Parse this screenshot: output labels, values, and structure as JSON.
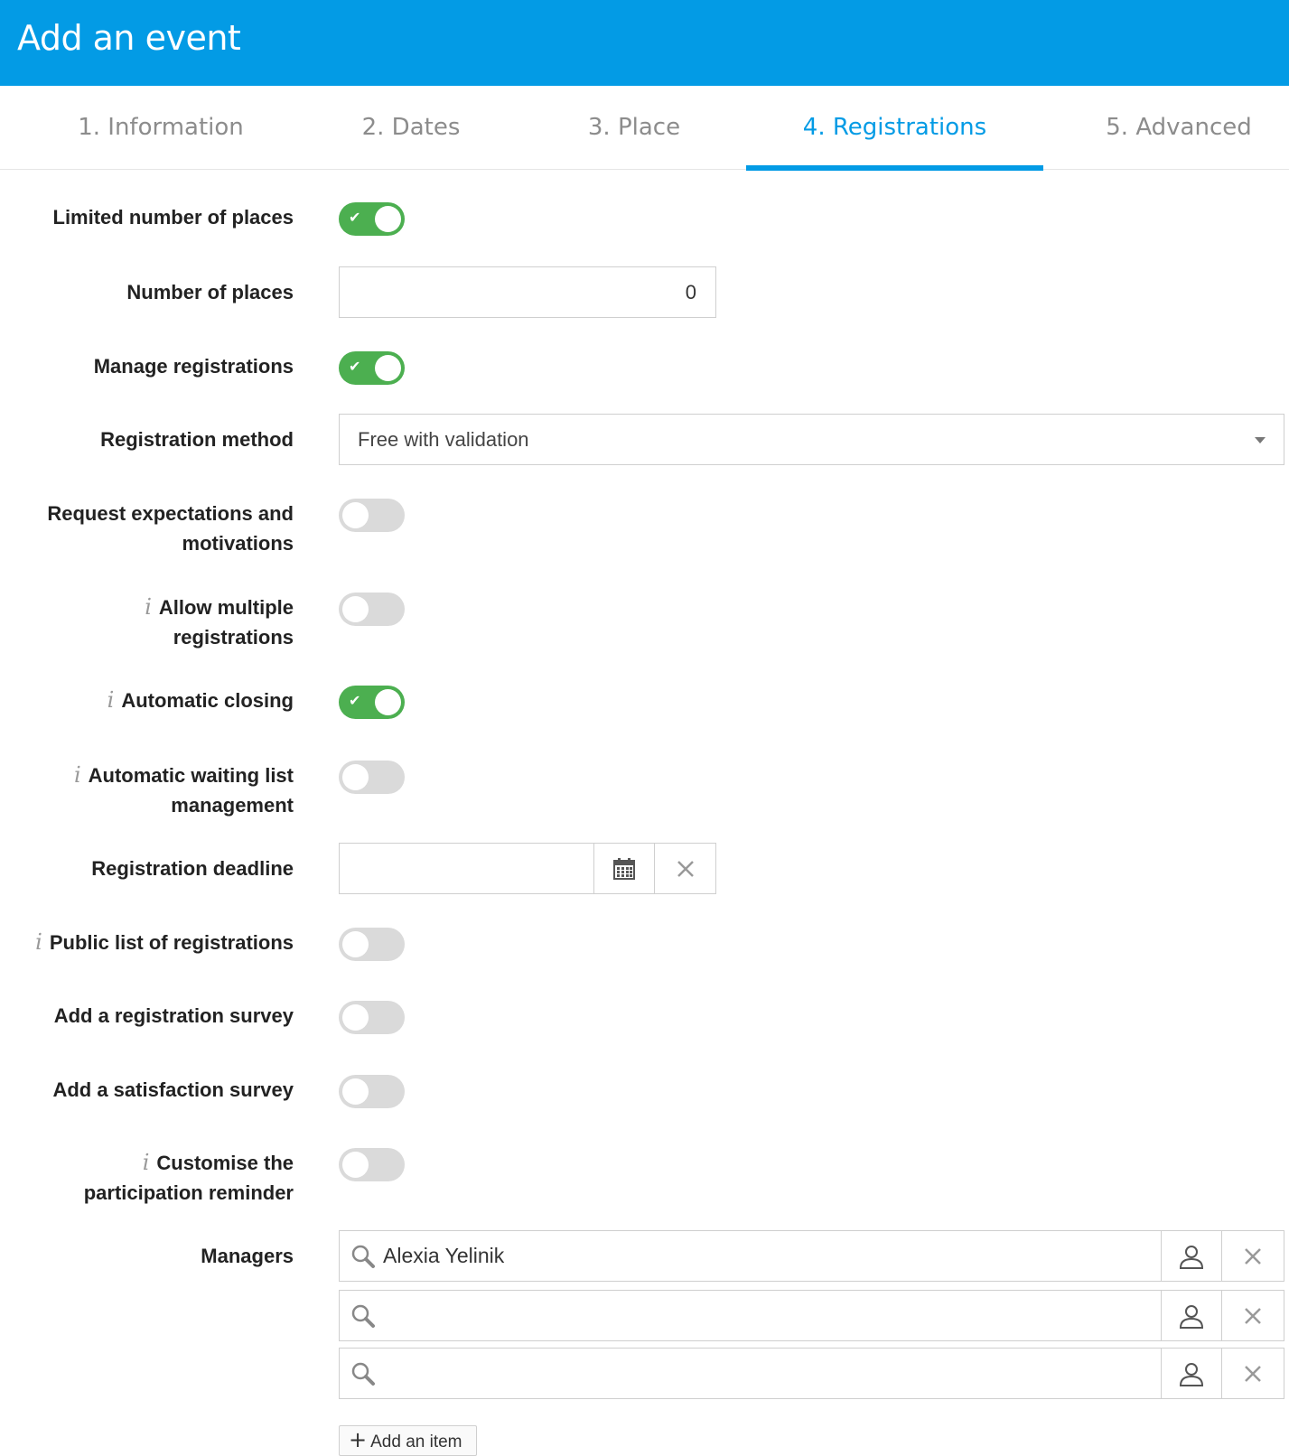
{
  "header": {
    "title": "Add an event"
  },
  "tabs": [
    {
      "label": "1. Information",
      "active": false
    },
    {
      "label": "2. Dates",
      "active": false
    },
    {
      "label": "3. Place",
      "active": false
    },
    {
      "label": "4. Registrations",
      "active": true
    },
    {
      "label": "5. Advanced",
      "active": false
    }
  ],
  "form": {
    "limited_places": {
      "label": "Limited number of places",
      "on": true
    },
    "number_of_places": {
      "label": "Number of places",
      "value": "0"
    },
    "manage_registrations": {
      "label": "Manage registrations",
      "on": true
    },
    "registration_method": {
      "label": "Registration method",
      "value": "Free with validation"
    },
    "request_expectations": {
      "label_line1": "Request expectations and",
      "label_line2": "motivations",
      "on": false
    },
    "allow_multiple": {
      "label_line1": "Allow multiple",
      "label_line2": "registrations",
      "on": false,
      "info": "i"
    },
    "automatic_closing": {
      "label": "Automatic closing",
      "on": true,
      "info": "i"
    },
    "waiting_list": {
      "label_line1": "Automatic waiting list",
      "label_line2": "management",
      "on": false,
      "info": "i"
    },
    "registration_deadline": {
      "label": "Registration deadline",
      "value": ""
    },
    "public_list": {
      "label": "Public list of registrations",
      "on": false,
      "info": "i"
    },
    "registration_survey": {
      "label": "Add a registration survey",
      "on": false
    },
    "satisfaction_survey": {
      "label": "Add a satisfaction survey",
      "on": false
    },
    "customise_reminder": {
      "label_line1": "Customise the",
      "label_line2": "participation reminder",
      "on": false,
      "info": "i"
    },
    "managers": {
      "label": "Managers",
      "items": [
        {
          "value": "Alexia Yelinik"
        },
        {
          "value": ""
        },
        {
          "value": ""
        }
      ],
      "add_label": "Add an item"
    }
  },
  "colors": {
    "accent": "#039be5",
    "toggle_on": "#4caf50",
    "toggle_off": "#dadada"
  },
  "icons": {
    "check": "check-icon",
    "calendar": "calendar-icon",
    "clear": "close-icon",
    "search": "search-icon",
    "user": "user-icon",
    "caret": "caret-down-icon"
  }
}
